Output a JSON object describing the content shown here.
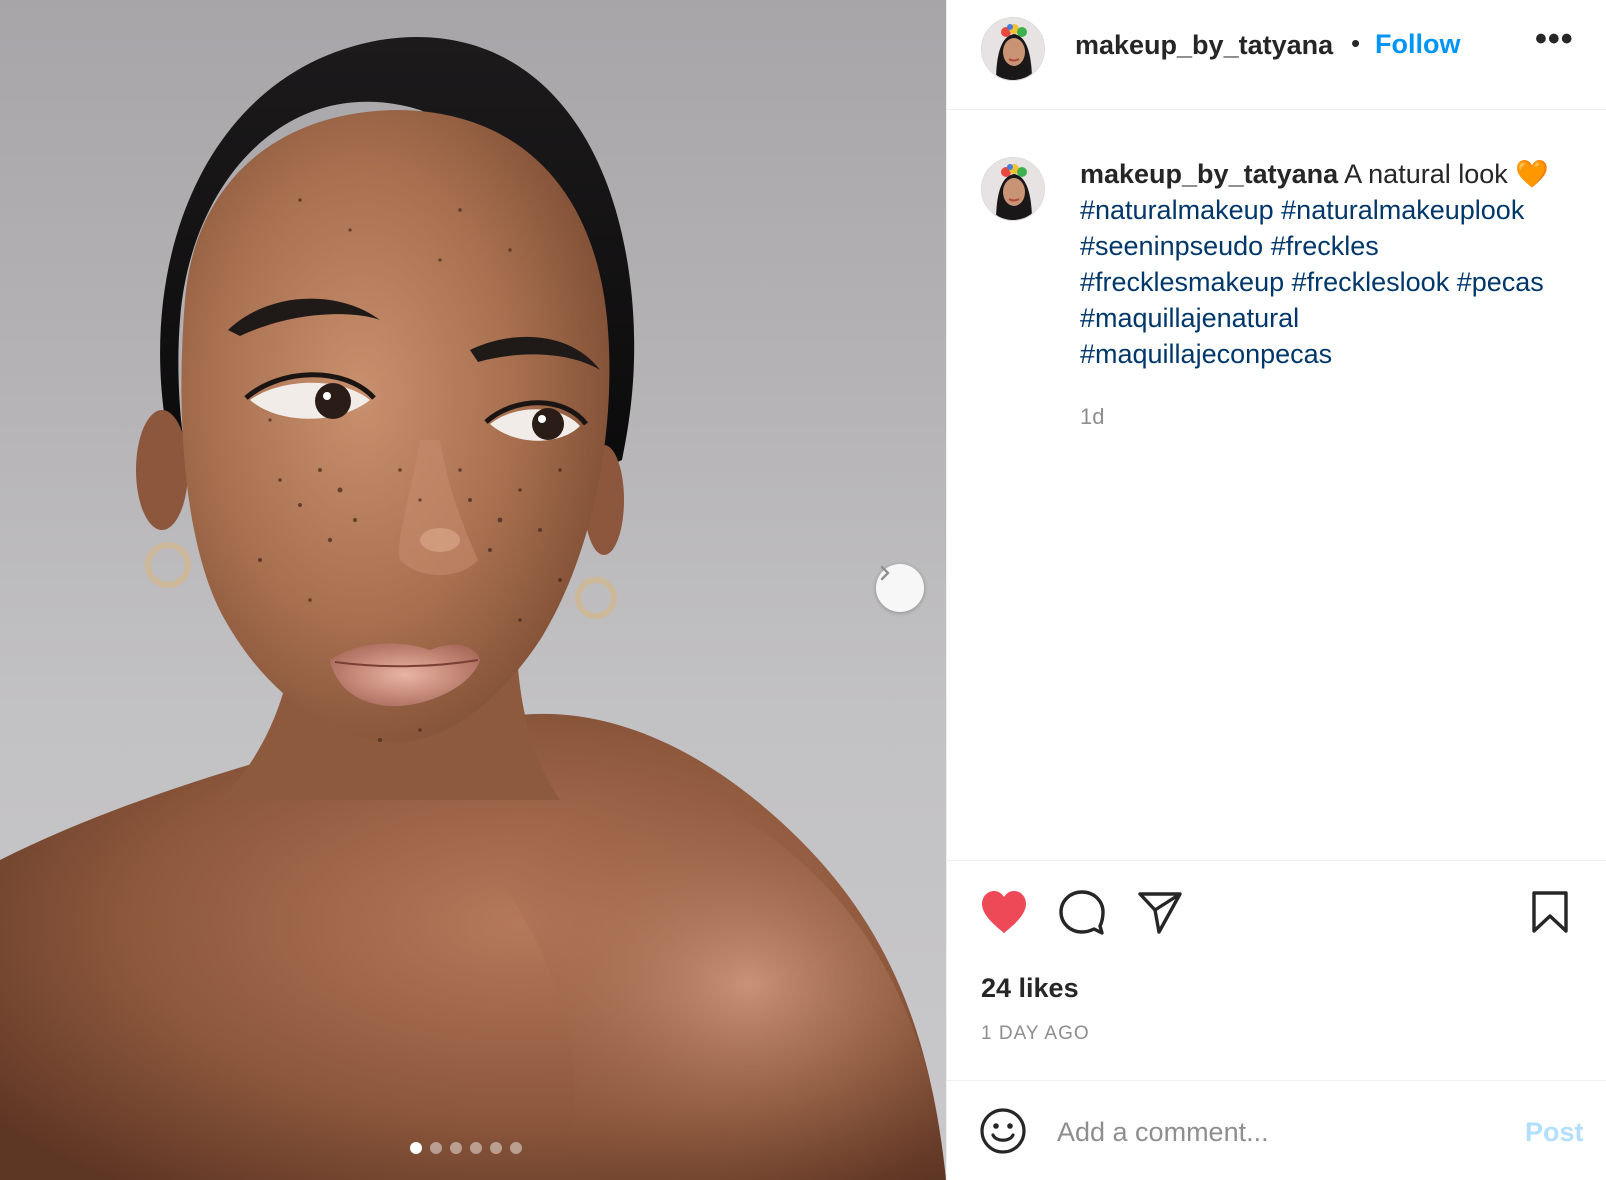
{
  "post": {
    "username": "makeup_by_tatyana",
    "follow_label": "Follow",
    "separator": "•",
    "more_label": "•••",
    "caption": {
      "username": "makeup_by_tatyana",
      "text": "A natural look",
      "emoji": "🧡",
      "hashtags": [
        "#naturalmakeup",
        "#naturalmakeuplook",
        "#seeninpseudo",
        "#freckles",
        "#frecklesmakeup",
        "#freckleslook",
        "#pecas",
        "#maquillajenatural",
        "#maquillajeconpecas"
      ],
      "time_relative": "1d"
    },
    "likes_text": "24 likes",
    "time_ago": "1 DAY AGO",
    "comment": {
      "placeholder": "Add a comment...",
      "post_label": "Post"
    },
    "carousel": {
      "total": 6,
      "active": 1
    },
    "icons": {
      "like": "heart-icon",
      "comment": "comment-icon",
      "share": "paper-plane-icon",
      "save": "bookmark-icon",
      "emoji": "smiley-icon",
      "next": "chevron-right-icon",
      "more": "more-icon"
    },
    "colors": {
      "follow": "#0095f6",
      "hashtag": "#00376b",
      "liked_heart": "#ed4956",
      "post_disabled": "#b2dffc",
      "muted": "#8e8e8e"
    }
  }
}
